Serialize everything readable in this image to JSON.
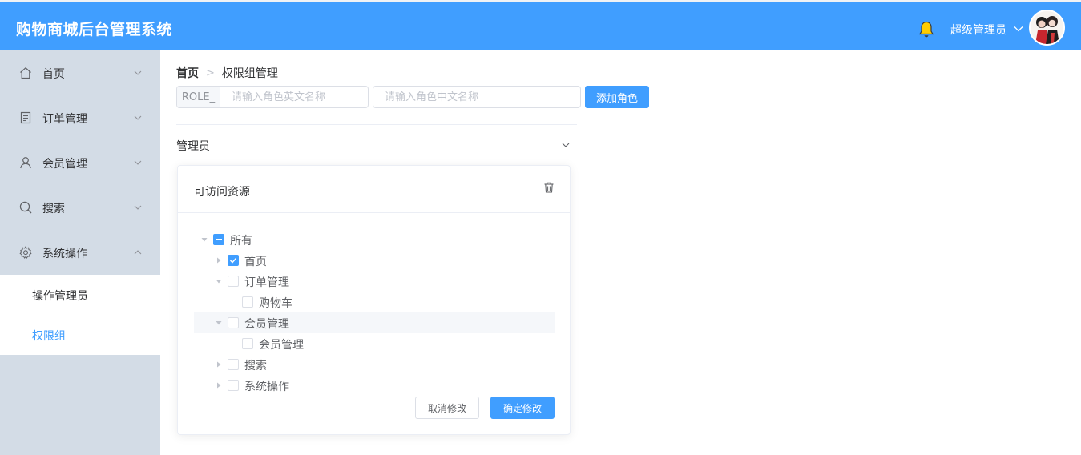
{
  "header": {
    "title": "购物商城后台管理系统",
    "user_name": "超级管理员",
    "bell_icon": "bell-icon",
    "avatar_icon": "user-avatar",
    "accent": "#409eff",
    "bell_color": "#ffcc00"
  },
  "sidebar": {
    "background": "#d3dce6",
    "items": [
      {
        "label": "首页",
        "icon": "home-icon",
        "arrow": "chevron-down-icon"
      },
      {
        "label": "订单管理",
        "icon": "document-icon",
        "arrow": "chevron-down-icon"
      },
      {
        "label": "会员管理",
        "icon": "user-icon",
        "arrow": "chevron-down-icon"
      },
      {
        "label": "搜索",
        "icon": "search-icon",
        "arrow": "chevron-down-icon"
      },
      {
        "label": "系统操作",
        "icon": "gear-icon",
        "arrow": "chevron-up-icon"
      }
    ],
    "submenu": [
      {
        "label": "操作管理员",
        "active": false
      },
      {
        "label": "权限组",
        "active": true
      }
    ]
  },
  "breadcrumb": {
    "home": "首页",
    "separator": ">",
    "current": "权限组管理"
  },
  "role_form": {
    "prefix": "ROLE_",
    "en_placeholder": "请输入角色英文名称",
    "cn_placeholder": "请输入角色中文名称",
    "add_button": "添加角色"
  },
  "collapse": {
    "title": "管理员",
    "arrow": "chevron-down-icon"
  },
  "card": {
    "title": "可访问资源",
    "delete_icon": "trash-icon",
    "cancel_button": "取消修改",
    "confirm_button": "确定修改"
  },
  "tree": [
    {
      "label": "所有",
      "level": 0,
      "expand": "expanded",
      "check": "indeterminate"
    },
    {
      "label": "首页",
      "level": 1,
      "expand": "collapsed",
      "check": "checked"
    },
    {
      "label": "订单管理",
      "level": 1,
      "expand": "expanded",
      "check": "unchecked"
    },
    {
      "label": "购物车",
      "level": 2,
      "expand": "leaf",
      "check": "unchecked"
    },
    {
      "label": "会员管理",
      "level": 1,
      "expand": "expanded",
      "check": "unchecked",
      "highlight": true
    },
    {
      "label": "会员管理",
      "level": 2,
      "expand": "leaf",
      "check": "unchecked"
    },
    {
      "label": "搜索",
      "level": 1,
      "expand": "collapsed",
      "check": "unchecked"
    },
    {
      "label": "系统操作",
      "level": 1,
      "expand": "collapsed",
      "check": "unchecked"
    }
  ]
}
